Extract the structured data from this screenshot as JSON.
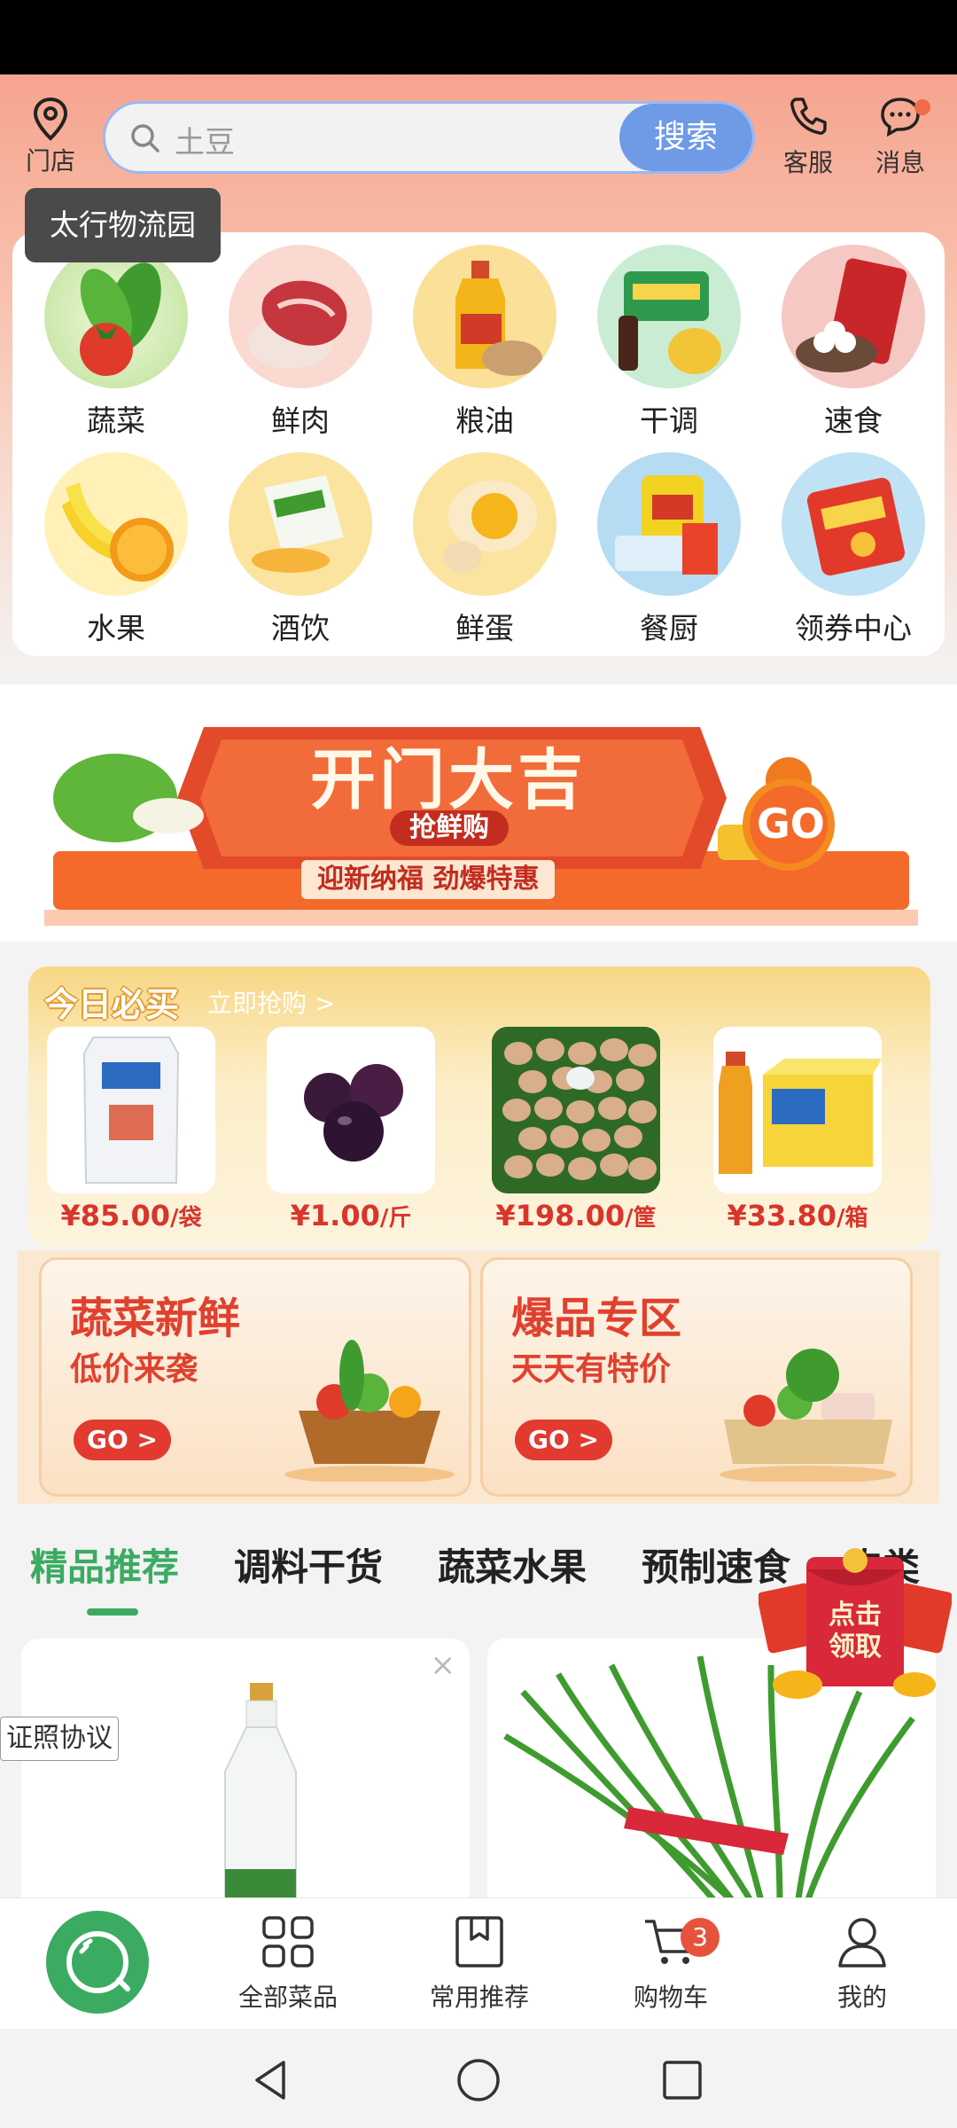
{
  "header": {
    "store_label": "门店",
    "search_placeholder": "土豆",
    "search_button": "搜索",
    "service_label": "客服",
    "message_label": "消息",
    "store_name": "太行物流园"
  },
  "categories": [
    {
      "label": "蔬菜",
      "icon": "vegetable-icon"
    },
    {
      "label": "鲜肉",
      "icon": "meat-icon"
    },
    {
      "label": "粮油",
      "icon": "grain-oil-icon"
    },
    {
      "label": "干调",
      "icon": "seasoning-icon"
    },
    {
      "label": "速食",
      "icon": "instant-food-icon"
    },
    {
      "label": "水果",
      "icon": "fruit-icon"
    },
    {
      "label": "酒饮",
      "icon": "drinks-icon"
    },
    {
      "label": "鲜蛋",
      "icon": "egg-icon"
    },
    {
      "label": "餐厨",
      "icon": "kitchen-icon"
    },
    {
      "label": "领券中心",
      "icon": "coupon-icon"
    }
  ],
  "banner": {
    "title": "开门大吉",
    "subtitle": "抢鲜购",
    "slogan": "迎新纳福 劲爆特惠",
    "go": "GO"
  },
  "today": {
    "title": "今日必买",
    "link": "立即抢购 >",
    "items": [
      {
        "price": "¥85.00",
        "unit": "/袋",
        "product": "flour-bag"
      },
      {
        "price": "¥1.00",
        "unit": "/斤",
        "product": "plums"
      },
      {
        "price": "¥198.00",
        "unit": "/筐",
        "product": "eggs"
      },
      {
        "price": "¥33.80",
        "unit": "/箱",
        "product": "iced-tea"
      }
    ]
  },
  "promos": [
    {
      "title": "蔬菜新鲜",
      "subtitle": "低价来袭",
      "go": "GO >"
    },
    {
      "title": "爆品专区",
      "subtitle": "天天有特价",
      "go": "GO >"
    }
  ],
  "tabs": [
    "精品推荐",
    "调料干货",
    "蔬菜水果",
    "预制速食",
    "肉类"
  ],
  "float": {
    "license": "证照协议",
    "redpack": "点击领取",
    "close": "×"
  },
  "bottom_nav": {
    "all": "全部菜品",
    "recommend": "常用推荐",
    "cart": "购物车",
    "cart_count": "3",
    "mine": "我的"
  },
  "colors": {
    "brand_green": "#3bab62",
    "search_blue": "#6e9ae6",
    "price_red": "#d8352b"
  }
}
